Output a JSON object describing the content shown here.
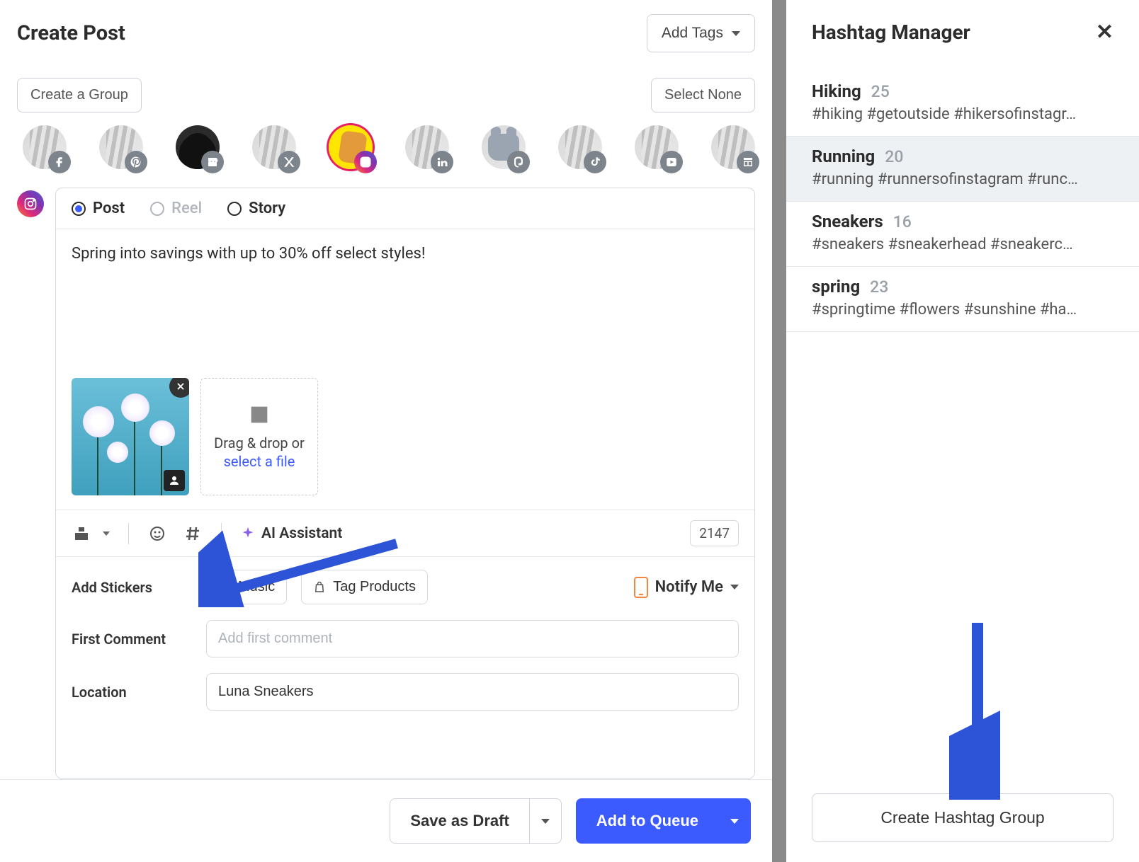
{
  "header": {
    "title": "Create Post",
    "add_tags_label": "Add Tags"
  },
  "group_row": {
    "create_group": "Create a Group",
    "select_none": "Select None"
  },
  "channels": [
    {
      "badge": "facebook"
    },
    {
      "badge": "pinterest"
    },
    {
      "badge": "gbp",
      "dark": true
    },
    {
      "badge": "x"
    },
    {
      "badge": "instagram",
      "selected": true
    },
    {
      "badge": "linkedin"
    },
    {
      "badge": "mastodon",
      "mastodon": true
    },
    {
      "badge": "tiktok"
    },
    {
      "badge": "youtube"
    },
    {
      "badge": "startpage"
    }
  ],
  "tabs": {
    "post": "Post",
    "reel": "Reel",
    "story": "Story"
  },
  "caption": "Spring into savings with up to 30% off select styles!",
  "upload": {
    "line1": "Drag & drop or ",
    "link": "select a file"
  },
  "toolbar": {
    "ai_assistant": "AI Assistant",
    "char_count": "2147"
  },
  "extras": {
    "stickers_label": "Add Stickers",
    "music_btn": "Music",
    "tag_products_btn": "Tag Products",
    "notify_label": "Notify Me",
    "first_comment_label": "First Comment",
    "first_comment_placeholder": "Add first comment",
    "location_label": "Location",
    "location_value": "Luna Sneakers"
  },
  "footer": {
    "save_draft": "Save as Draft",
    "add_queue": "Add to Queue"
  },
  "side": {
    "title": "Hashtag Manager",
    "create_btn": "Create Hashtag Group",
    "groups": [
      {
        "name": "Hiking",
        "count": "25",
        "preview": "#hiking #getoutside #hikersofinstagr…"
      },
      {
        "name": "Running",
        "count": "20",
        "preview": "#running #runnersofinstagram #runc…",
        "active": true
      },
      {
        "name": "Sneakers",
        "count": "16",
        "preview": "#sneakers #sneakerhead #sneakerc…"
      },
      {
        "name": "spring",
        "count": "23",
        "preview": "#springtime #flowers #sunshine #ha…"
      }
    ]
  }
}
